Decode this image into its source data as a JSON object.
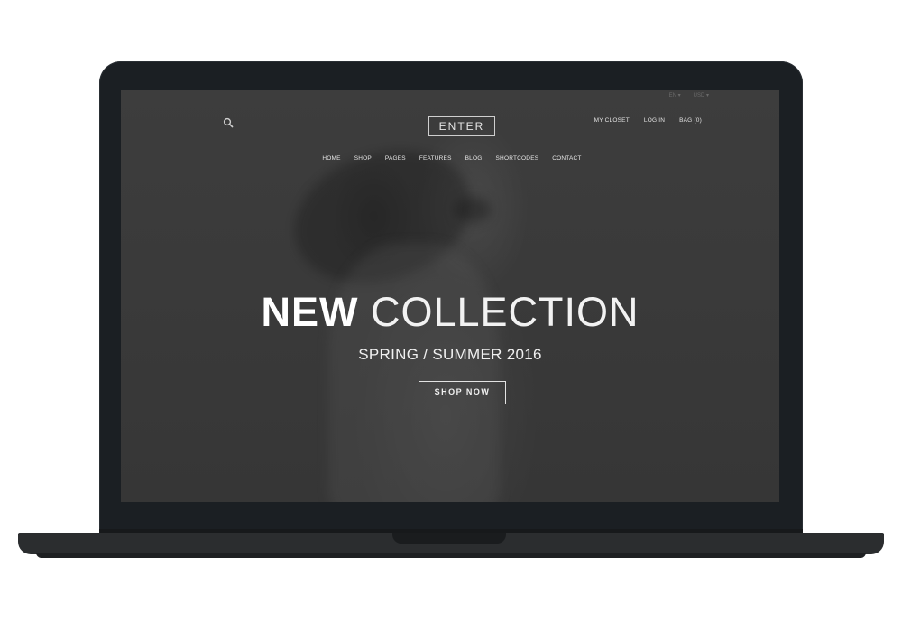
{
  "site": {
    "logo": "ENTER",
    "search_icon": "search-icon",
    "top_links": [
      "MY CLOSET",
      "LOG IN",
      "BAG (0)"
    ],
    "utility_links": [
      "EN ▾",
      "USD ▾"
    ],
    "nav": [
      "HOME",
      "SHOP",
      "PAGES",
      "FEATURES",
      "BLOG",
      "SHORTCODES",
      "CONTACT"
    ]
  },
  "hero": {
    "title_bold": "NEW",
    "title_light": "COLLECTION",
    "subtitle": "SPRING / SUMMER 2016",
    "cta": "SHOP NOW"
  },
  "colors": {
    "lid": "#1b1f23",
    "screen_bg": "#3a3a3a",
    "text": "#ffffff",
    "base": "#2b2d2f"
  }
}
